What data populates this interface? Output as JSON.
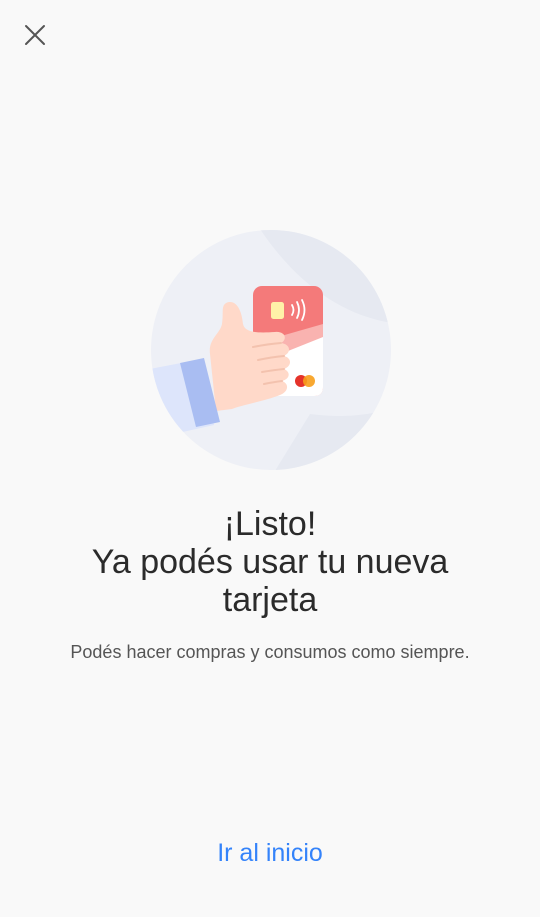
{
  "header": {
    "close_icon": "close-icon"
  },
  "illustration": {
    "icon": "hand-holding-card-icon",
    "colors": {
      "circle_bg": "#eef0f6",
      "card": "#f47a7a",
      "sleeve": "#a9bdf2",
      "skin": "#ffd9c9",
      "chip": "#fff2a8",
      "brand_red": "#e5332a",
      "brand_orange": "#f79e1b"
    }
  },
  "message": {
    "title_line1": "¡Listo!",
    "title_line2": "Ya podés usar tu nueva",
    "title_line3": "tarjeta",
    "subtitle": "Podés hacer compras y consumos como siempre."
  },
  "actions": {
    "home_label": "Ir al inicio"
  },
  "colors": {
    "background": "#f9f9f9",
    "link": "#3483fa",
    "text": "#2b2b2b"
  }
}
